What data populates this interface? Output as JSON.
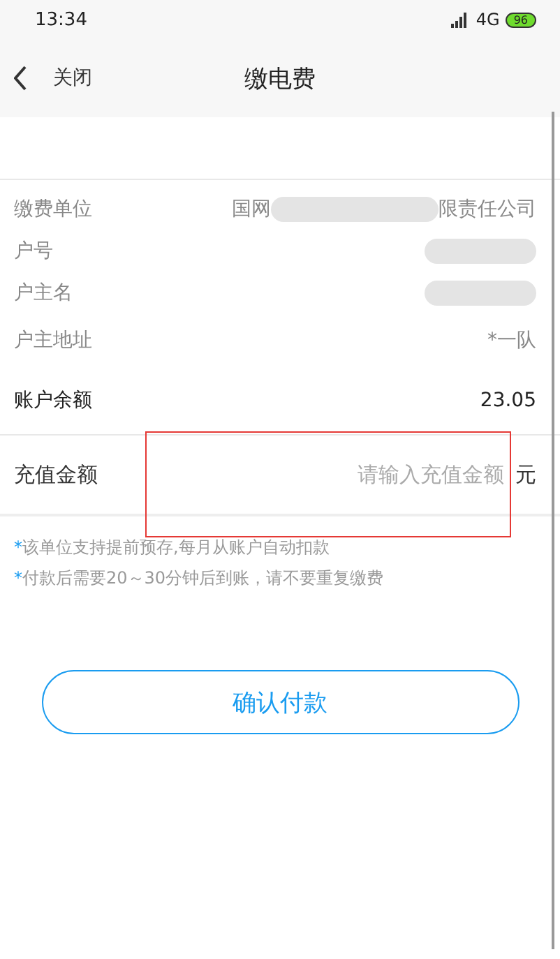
{
  "status_bar": {
    "time": "13:34",
    "network": "4G",
    "battery": "96"
  },
  "nav_bar": {
    "back": "关闭",
    "title": "缴电费"
  },
  "info_rows": [
    {
      "label": "缴费单位",
      "value_start": "国网",
      "value_end": "限责任公司",
      "blurred": true,
      "kind": "muted"
    },
    {
      "label": "户号",
      "blurred": true,
      "kind": "muted"
    },
    {
      "label": "户主名",
      "blurred": true,
      "kind": "muted"
    },
    {
      "label": "户主地址",
      "value_end": "*一队",
      "blurred": false,
      "kind": "muted"
    },
    {
      "label": "账户余额",
      "value_end": "23.05",
      "blurred": false,
      "kind": "strong"
    }
  ],
  "amount_field": {
    "label": "充值金额",
    "placeholder": "请输入充值金额",
    "unit": "元",
    "highlighted": true
  },
  "notes": [
    {
      "mark": "*",
      "text": "该单位支持提前预存,每月从账户自动扣款"
    },
    {
      "mark": "*",
      "text": "付款后需要20～30分钟后到账，请不要重复缴费"
    }
  ],
  "confirm_button": "确认付款"
}
